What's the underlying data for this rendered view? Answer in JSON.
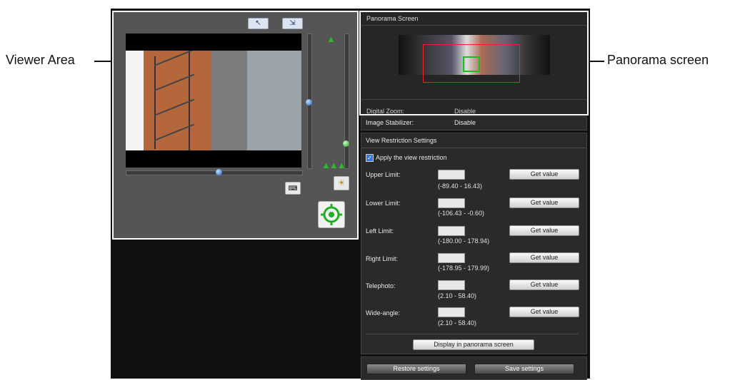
{
  "callouts": {
    "viewer_area": "Viewer Area",
    "panorama_screen": "Panorama screen"
  },
  "viewer": {
    "toolbar_icons": [
      "pointer-icon",
      "screen-resize-icon"
    ],
    "zoom_slider_value": 0.42,
    "pan_slider_value": 0.52,
    "brightness_slider_value": 0.9
  },
  "panorama": {
    "title": "Panorama Screen",
    "digital_zoom_label": "Digital Zoom:",
    "digital_zoom_value": "Disable"
  },
  "settings": {
    "image_stabilizer_label": "Image Stabilizer:",
    "image_stabilizer_value": "Disable",
    "view_restriction_title": "View Restriction Settings",
    "apply_label": "Apply the view restriction",
    "apply_checked": true,
    "get_value_label": "Get value",
    "limits": [
      {
        "label": "Upper Limit:",
        "range": "(-89.40 - 16.43)"
      },
      {
        "label": "Lower Limit:",
        "range": "(-106.43 - -0.60)"
      },
      {
        "label": "Left Limit:",
        "range": "(-180.00 - 178.94)"
      },
      {
        "label": "Right Limit:",
        "range": "(-178.95 - 179.99)"
      },
      {
        "label": "Telephoto:",
        "range": "(2.10 - 58.40)"
      },
      {
        "label": "Wide-angle:",
        "range": "(2.10 - 58.40)"
      }
    ],
    "display_panorama_label": "Display in panorama screen",
    "restore_label": "Restore settings",
    "save_label": "Save settings"
  },
  "colors": {
    "panel_bg": "#2a2a2a",
    "frame_border": "#ffffff",
    "pano_red": "#e22222",
    "pano_green": "#19c019"
  }
}
